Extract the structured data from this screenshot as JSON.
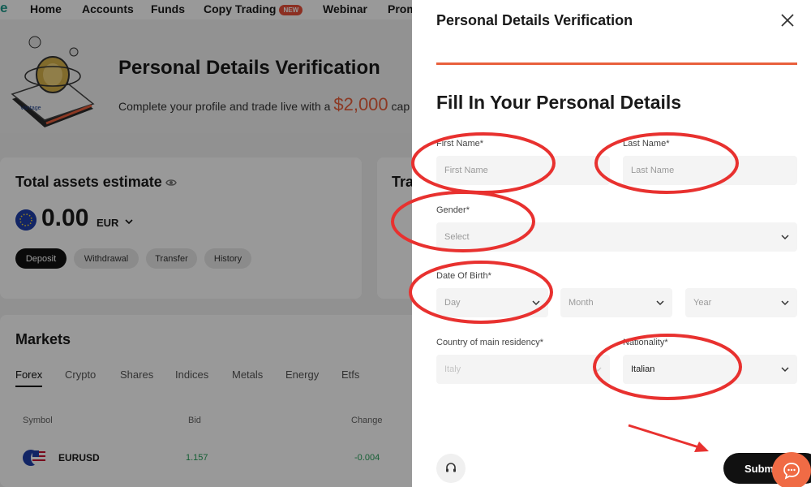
{
  "topnav": {
    "logo_letter": "e",
    "items": [
      "Home",
      "Accounts",
      "Funds",
      "Copy Trading",
      "Webinar",
      "Prom"
    ],
    "new_badge": "NEW"
  },
  "hero": {
    "title": "Personal Details Verification",
    "subtitle_pre": "Complete your profile and trade live with a ",
    "subtitle_amount": "$2,000",
    "subtitle_post": " cap"
  },
  "assets": {
    "title": "Total assets estimate",
    "amount": "0.00",
    "currency": "EUR",
    "buttons": [
      "Deposit",
      "Withdrawal",
      "Transfer",
      "History"
    ]
  },
  "trading_card": {
    "title": "Tra"
  },
  "markets": {
    "title": "Markets",
    "tabs": [
      "Forex",
      "Crypto",
      "Shares",
      "Indices",
      "Metals",
      "Energy",
      "Etfs"
    ],
    "columns": [
      "Symbol",
      "Bid",
      "Change"
    ],
    "rows": [
      {
        "symbol": "EURUSD",
        "bid": "1.157",
        "change": "-0.004"
      }
    ]
  },
  "drawer": {
    "title": "Personal Details Verification",
    "heading": "Fill In Your Personal Details",
    "first_name": {
      "label": "First Name*",
      "placeholder": "First Name"
    },
    "last_name": {
      "label": "Last Name*",
      "placeholder": "Last Name"
    },
    "gender": {
      "label": "Gender*",
      "placeholder": "Select"
    },
    "dob": {
      "label": "Date Of Birth*",
      "day": "Day",
      "month": "Month",
      "year": "Year"
    },
    "country": {
      "label": "Country of main residency*",
      "value": "Italy"
    },
    "nationality": {
      "label": "Nationality*",
      "value": "Italian"
    },
    "submit": "Submi"
  },
  "colors": {
    "accent": "#e9603c",
    "annotation": "#e8312f",
    "positive": "#27a05a",
    "chat": "#f06b45"
  },
  "icons": [
    "eye-icon",
    "chevron-down-icon",
    "close-icon",
    "headset-icon",
    "chat-icon",
    "eu-flag-icon",
    "us-flag-icon"
  ]
}
